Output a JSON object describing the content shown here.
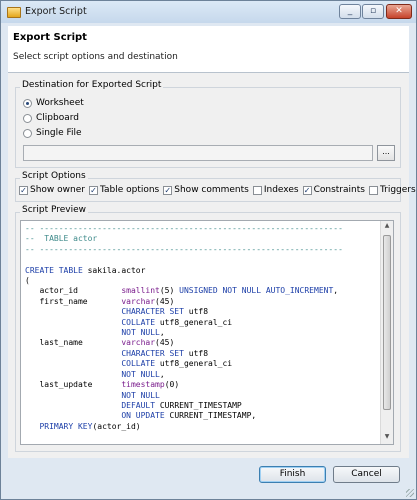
{
  "window": {
    "title": "Export Script"
  },
  "header": {
    "title": "Export Script",
    "subtitle": "Select script options and destination"
  },
  "destination": {
    "label": "Destination for Exported Script",
    "options": [
      "Worksheet",
      "Clipboard",
      "Single File"
    ],
    "selected": "Worksheet",
    "path_value": "",
    "browse_label": "..."
  },
  "script_options": {
    "label": "Script Options",
    "items": [
      {
        "label": "Show owner",
        "checked": true
      },
      {
        "label": "Table options",
        "checked": true
      },
      {
        "label": "Show comments",
        "checked": true
      },
      {
        "label": "Indexes",
        "checked": false
      },
      {
        "label": "Constraints",
        "checked": true
      },
      {
        "label": "Triggers",
        "checked": false
      }
    ]
  },
  "preview": {
    "label": "Script Preview",
    "lines": [
      "-- ---------------------------------------------------------------",
      "--  TABLE actor",
      "-- ---------------------------------------------------------------",
      "",
      "CREATE TABLE sakila.actor",
      "(",
      "   actor_id         smallint(5) UNSIGNED NOT NULL AUTO_INCREMENT,",
      "   first_name       varchar(45)",
      "                    CHARACTER SET utf8",
      "                    COLLATE utf8_general_ci",
      "                    NOT NULL,",
      "   last_name        varchar(45)",
      "                    CHARACTER SET utf8",
      "                    COLLATE utf8_general_ci",
      "                    NOT NULL,",
      "   last_update      timestamp(0)",
      "                    NOT NULL",
      "                    DEFAULT CURRENT_TIMESTAMP",
      "                    ON UPDATE CURRENT_TIMESTAMP,",
      "   PRIMARY KEY(actor_id)"
    ]
  },
  "buttons": {
    "finish": "Finish",
    "cancel": "Cancel"
  },
  "colors": {
    "comment": "#3e8a8a",
    "keyword": "#7a1c8c",
    "type": "#1d3fa8"
  }
}
